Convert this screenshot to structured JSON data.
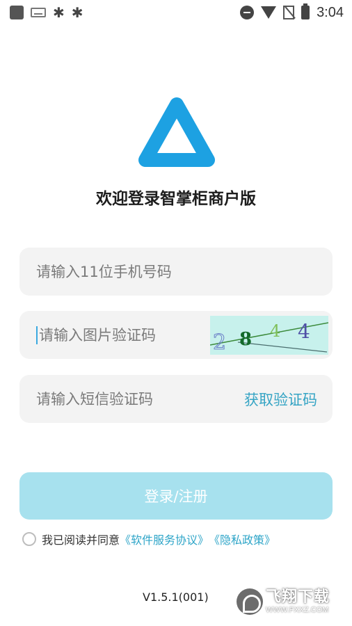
{
  "status_bar": {
    "time": "3:04",
    "left_icons": [
      "app-square-icon",
      "keyboard-icon",
      "bug-icon",
      "bug-icon"
    ],
    "right_icons": [
      "do-not-disturb-icon",
      "wifi-icon",
      "no-sim-icon",
      "battery-icon"
    ]
  },
  "header": {
    "logo_icon": "triangle-logo-icon",
    "welcome_text": "欢迎登录智掌柜商户版"
  },
  "form": {
    "phone_placeholder": "请输入11位手机号码",
    "captcha_placeholder": "请输入图片验证码",
    "captcha_image_text": "2844",
    "sms_placeholder": "请输入短信验证码",
    "sms_button": "获取验证码",
    "login_button": "登录/注册"
  },
  "agreement": {
    "prefix": "我已阅读并同意",
    "terms_link": "《软件服务协议》",
    "privacy_link": "《隐私政策》",
    "checked": false
  },
  "footer": {
    "version": "V1.5.1(001)"
  },
  "watermark": {
    "title": "飞翔下载",
    "url": "WWW.FXXZ.COM"
  },
  "colors": {
    "accent": "#1da1e2",
    "link": "#2ea5c8",
    "button_disabled": "#a7e1ee",
    "field_bg": "#f3f3f3",
    "captcha_bg": "#c7f1ec"
  }
}
